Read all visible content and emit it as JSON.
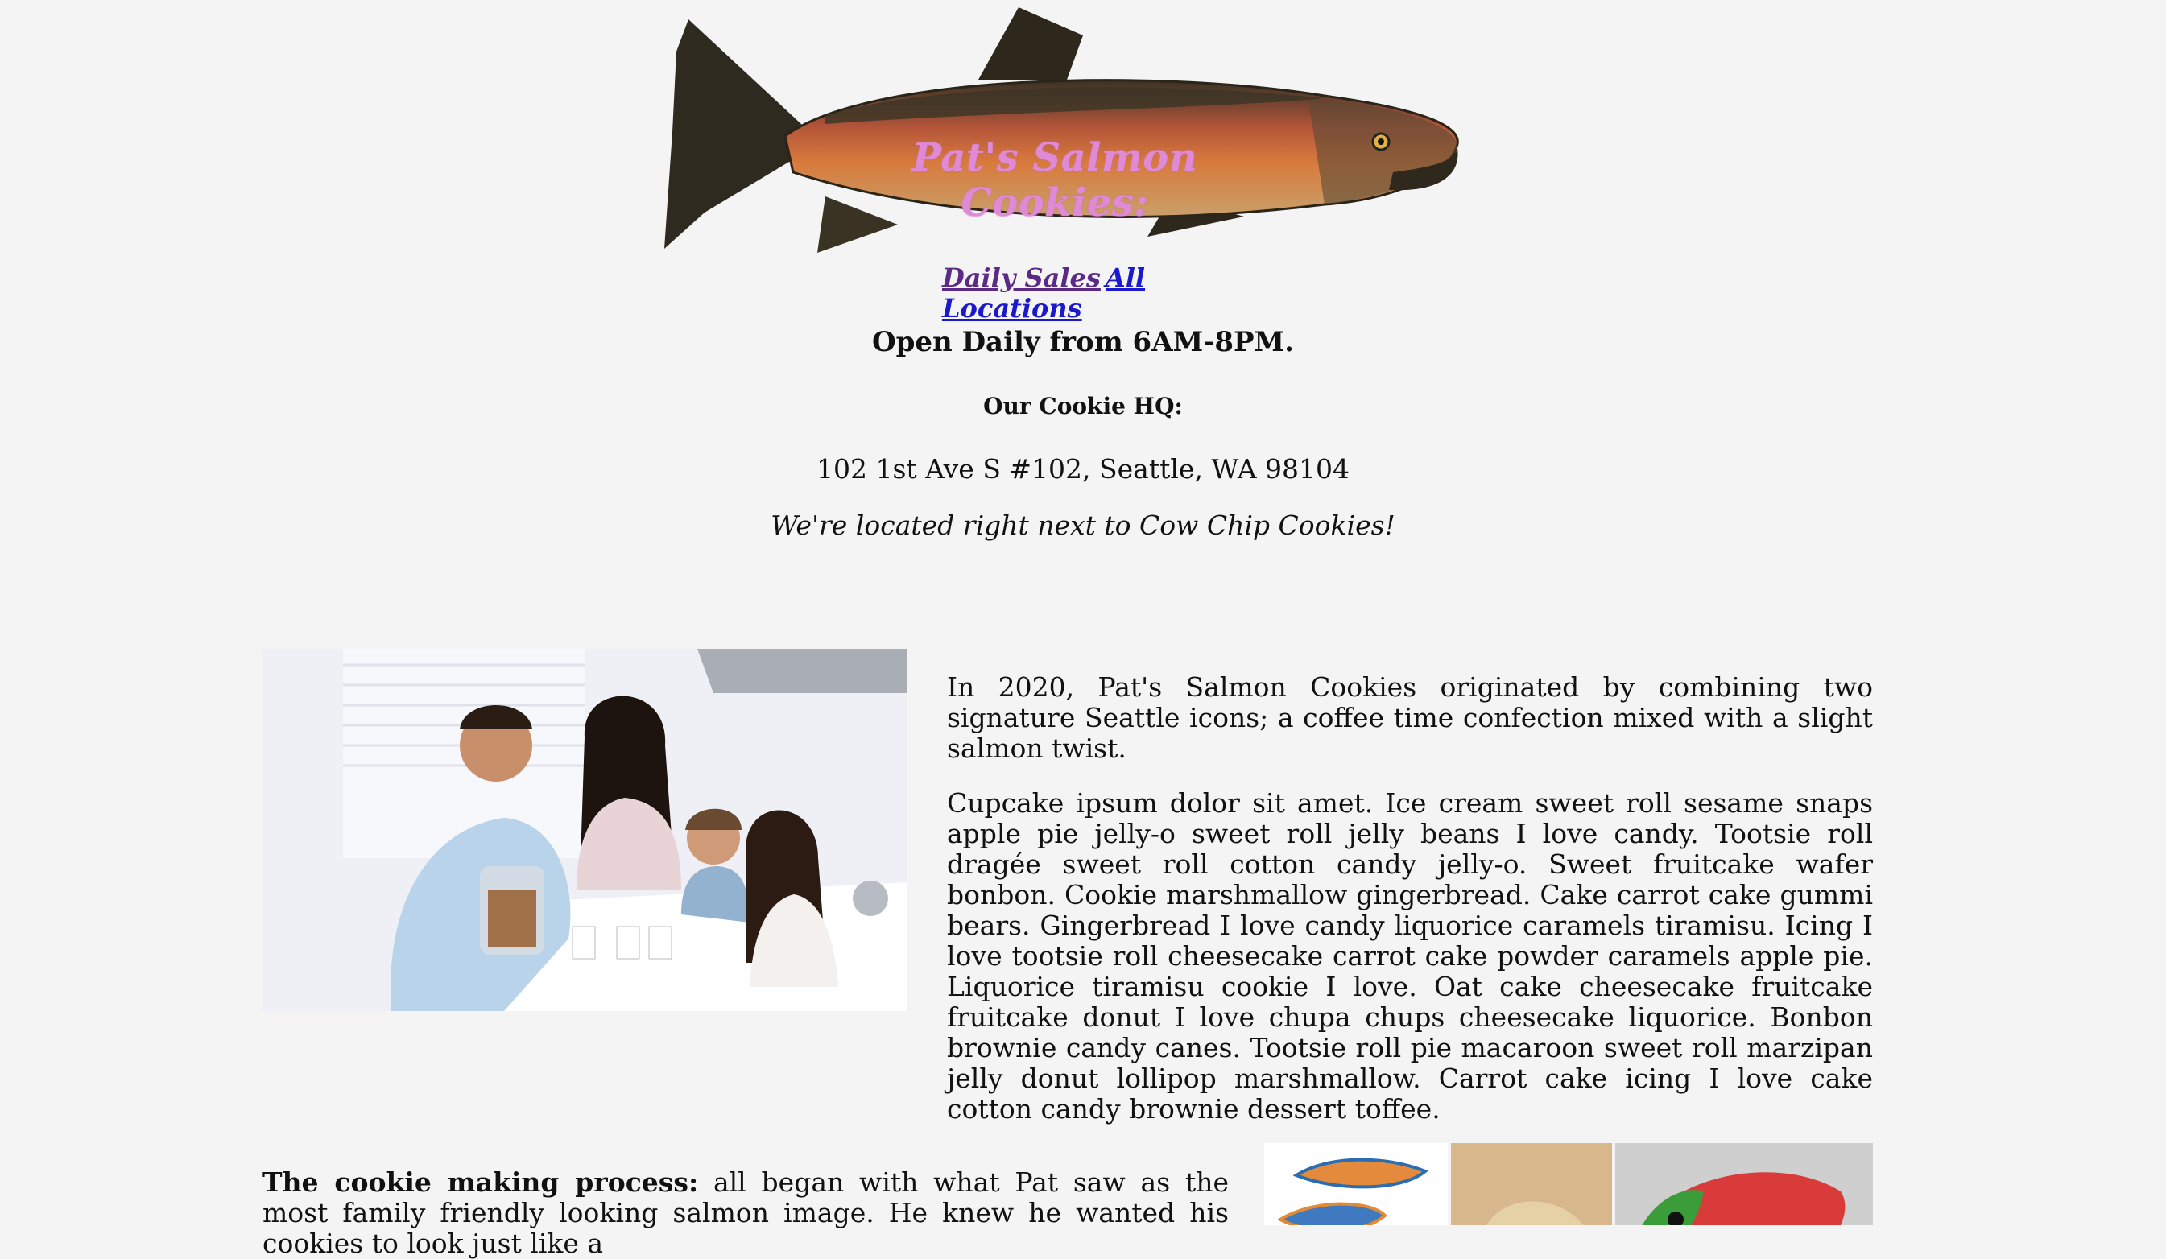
{
  "header": {
    "brand_title": "Pat's Salmon Cookies:",
    "nav": [
      {
        "label": "Daily Sales",
        "state": "visited"
      },
      {
        "label": "All Locations",
        "state": "link"
      }
    ]
  },
  "info": {
    "hours": "Open Daily from 6AM-8PM.",
    "hq_label": "Our Cookie HQ:",
    "address": "102 1st Ave S #102, Seattle, WA 98104",
    "note": "We're located right next to Cow Chip Cookies!"
  },
  "story": {
    "p1": "In 2020, Pat's Salmon Cookies originated by combining two signature Seattle icons; a coffee time confection mixed with a slight salmon twist.",
    "p2": "Cupcake ipsum dolor sit amet. Ice cream sweet roll sesame snaps apple pie jelly-o sweet roll jelly beans I love candy. Tootsie roll dragée sweet roll cotton candy jelly-o. Sweet fruitcake wafer bonbon. Cookie marshmallow gingerbread. Cake carrot cake gummi bears. Gingerbread I love candy liquorice caramels tiramisu. Icing I love tootsie roll cheesecake carrot cake powder caramels apple pie. Liquorice tiramisu cookie I love. Oat cake cheesecake fruitcake fruitcake donut I love chupa chups cheesecake liquorice. Bonbon brownie candy canes. Tootsie roll pie macaroon sweet roll marzipan jelly donut lollipop marshmallow. Carrot cake icing I love cake cotton candy brownie dessert toffee."
  },
  "process": {
    "lead": "The cookie making process:",
    "text": "all began with what Pat saw as the most family friendly looking salmon image. He knew he wanted his cookies to look just like a"
  },
  "images": {
    "hero": "salmon-illustration",
    "family": "family-photo",
    "thumbs": [
      "salmon-cookie-cutter",
      "salmon-cookie-baked",
      "salmon-cookie-iced"
    ]
  },
  "colors": {
    "background": "#f4f4f4",
    "brand_title": "#e08ad6",
    "nav_visited": "#5b2a86",
    "nav_link": "#1a1acc"
  }
}
